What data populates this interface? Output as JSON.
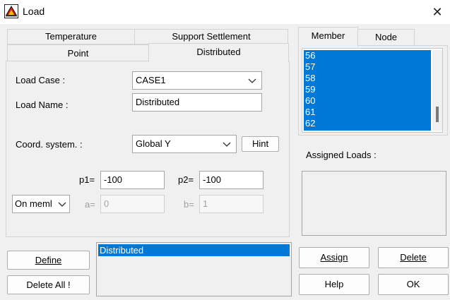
{
  "window": {
    "title": "Load",
    "close_symbol": "✕"
  },
  "tabs_top": [
    "Temperature",
    "Support Settlement"
  ],
  "tabs_bottom": [
    "Point",
    "Distributed"
  ],
  "right_tabs": [
    "Member",
    "Node"
  ],
  "form": {
    "load_case_label": "Load Case :",
    "load_case_value": "CASE1",
    "load_name_label": "Load Name :",
    "load_name_value": "Distributed",
    "coord_label": "Coord. system. :",
    "coord_value": "Global Y",
    "hint_label": "Hint",
    "p1_label": "p1=",
    "p1_value": "-100",
    "p2_label": "p2=",
    "p2_value": "-100",
    "mode_value": "On meml",
    "a_label": "a=",
    "a_value": "0",
    "b_label": "b=",
    "b_value": "1"
  },
  "members": [
    "56",
    "57",
    "58",
    "59",
    "60",
    "61",
    "62"
  ],
  "assigned_loads_label": "Assigned Loads :",
  "load_list": [
    "Distributed"
  ],
  "buttons": {
    "define": "Define",
    "delete_all": "Delete All !",
    "assign": "Assign",
    "delete": "Delete",
    "help": "Help",
    "ok": "OK"
  }
}
